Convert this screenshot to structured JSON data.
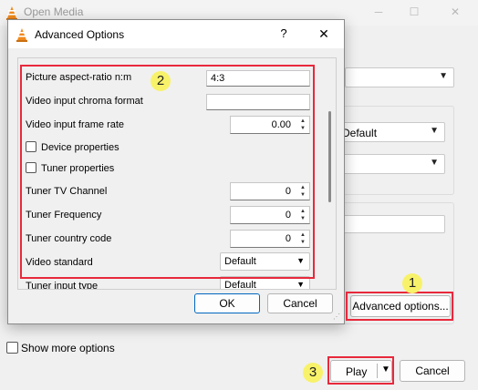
{
  "background_window": {
    "title": "Open Media",
    "window_controls": {
      "minimize": "─",
      "maximize": "☐",
      "close": "✕"
    },
    "combo_top_value": "",
    "combo_default_value": "Default",
    "combo_second_value": "",
    "advanced_options_label": "Advanced options...",
    "show_more_label": "Show more options",
    "show_more_checked": false,
    "play_label": "Play",
    "cancel_label": "Cancel"
  },
  "dialog": {
    "title": "Advanced Options",
    "help_glyph": "?",
    "close_glyph": "✕",
    "fields": {
      "aspect_ratio": {
        "label": "Picture aspect-ratio n:m",
        "value": "4:3"
      },
      "chroma_format": {
        "label": "Video input chroma format",
        "value": ""
      },
      "frame_rate": {
        "label": "Video input frame rate",
        "value": "0.00"
      },
      "device_properties": {
        "label": "Device properties",
        "checked": false
      },
      "tuner_properties": {
        "label": "Tuner properties",
        "checked": false
      },
      "tv_channel": {
        "label": "Tuner TV Channel",
        "value": "0"
      },
      "frequency": {
        "label": "Tuner Frequency",
        "value": "0"
      },
      "country_code": {
        "label": "Tuner country code",
        "value": "0"
      },
      "video_standard": {
        "label": "Video standard",
        "value": "Default"
      },
      "input_type": {
        "label": "Tuner input type",
        "value": "Default"
      }
    },
    "ok_label": "OK",
    "cancel_label": "Cancel"
  },
  "annotations": {
    "badge_1": "1",
    "badge_2": "2",
    "badge_3": "3",
    "highlight_color": "#e8293c",
    "badge_color": "#f8f26a"
  },
  "icons": [
    "vlc-cone-icon",
    "help-icon",
    "close-icon",
    "chevron-down-icon",
    "spin-up-icon",
    "spin-down-icon",
    "resize-grip-icon"
  ]
}
